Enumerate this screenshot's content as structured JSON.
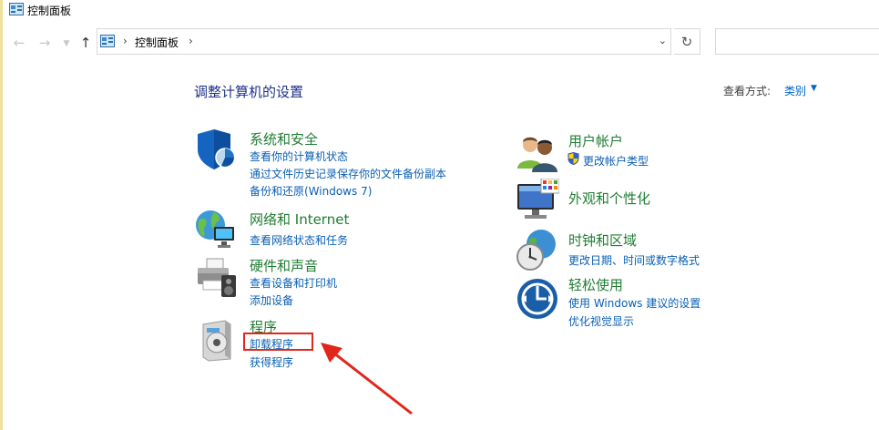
{
  "window": {
    "title": "控制面板"
  },
  "nav": {
    "back_icon": "arrow-left-icon",
    "forward_icon": "arrow-right-icon",
    "recent_icon": "chevron-down-icon",
    "up_icon": "arrow-up-icon"
  },
  "address": {
    "crumb": "控制面板",
    "sep": "›",
    "dropdown": "⌄"
  },
  "page": {
    "heading": "调整计算机的设置",
    "view_by_label": "查看方式:",
    "view_by_value": "类别",
    "view_by_arrow": "▼"
  },
  "categories": {
    "system": {
      "title": "系统和安全",
      "links": [
        "查看你的计算机状态",
        "通过文件历史记录保存你的文件备份副本",
        "备份和还原(Windows 7)"
      ]
    },
    "network": {
      "title": "网络和 Internet",
      "links": [
        "查看网络状态和任务"
      ]
    },
    "hardware": {
      "title": "硬件和声音",
      "links": [
        "查看设备和打印机",
        "添加设备"
      ]
    },
    "programs": {
      "title": "程序",
      "links": [
        "卸载程序",
        "获得程序"
      ]
    },
    "users": {
      "title": "用户帐户",
      "links": [
        "更改帐户类型"
      ]
    },
    "appearance": {
      "title": "外观和个性化",
      "links": []
    },
    "clock": {
      "title": "时钟和区域",
      "links": [
        "更改日期、时间或数字格式"
      ]
    },
    "ease": {
      "title": "轻松使用",
      "links": [
        "使用 Windows 建议的设置",
        "优化视觉显示"
      ]
    }
  },
  "colors": {
    "category_title": "#1f7d32",
    "link": "#0a5fb4",
    "heading": "#1e3287",
    "annotation": "#e1261c"
  }
}
